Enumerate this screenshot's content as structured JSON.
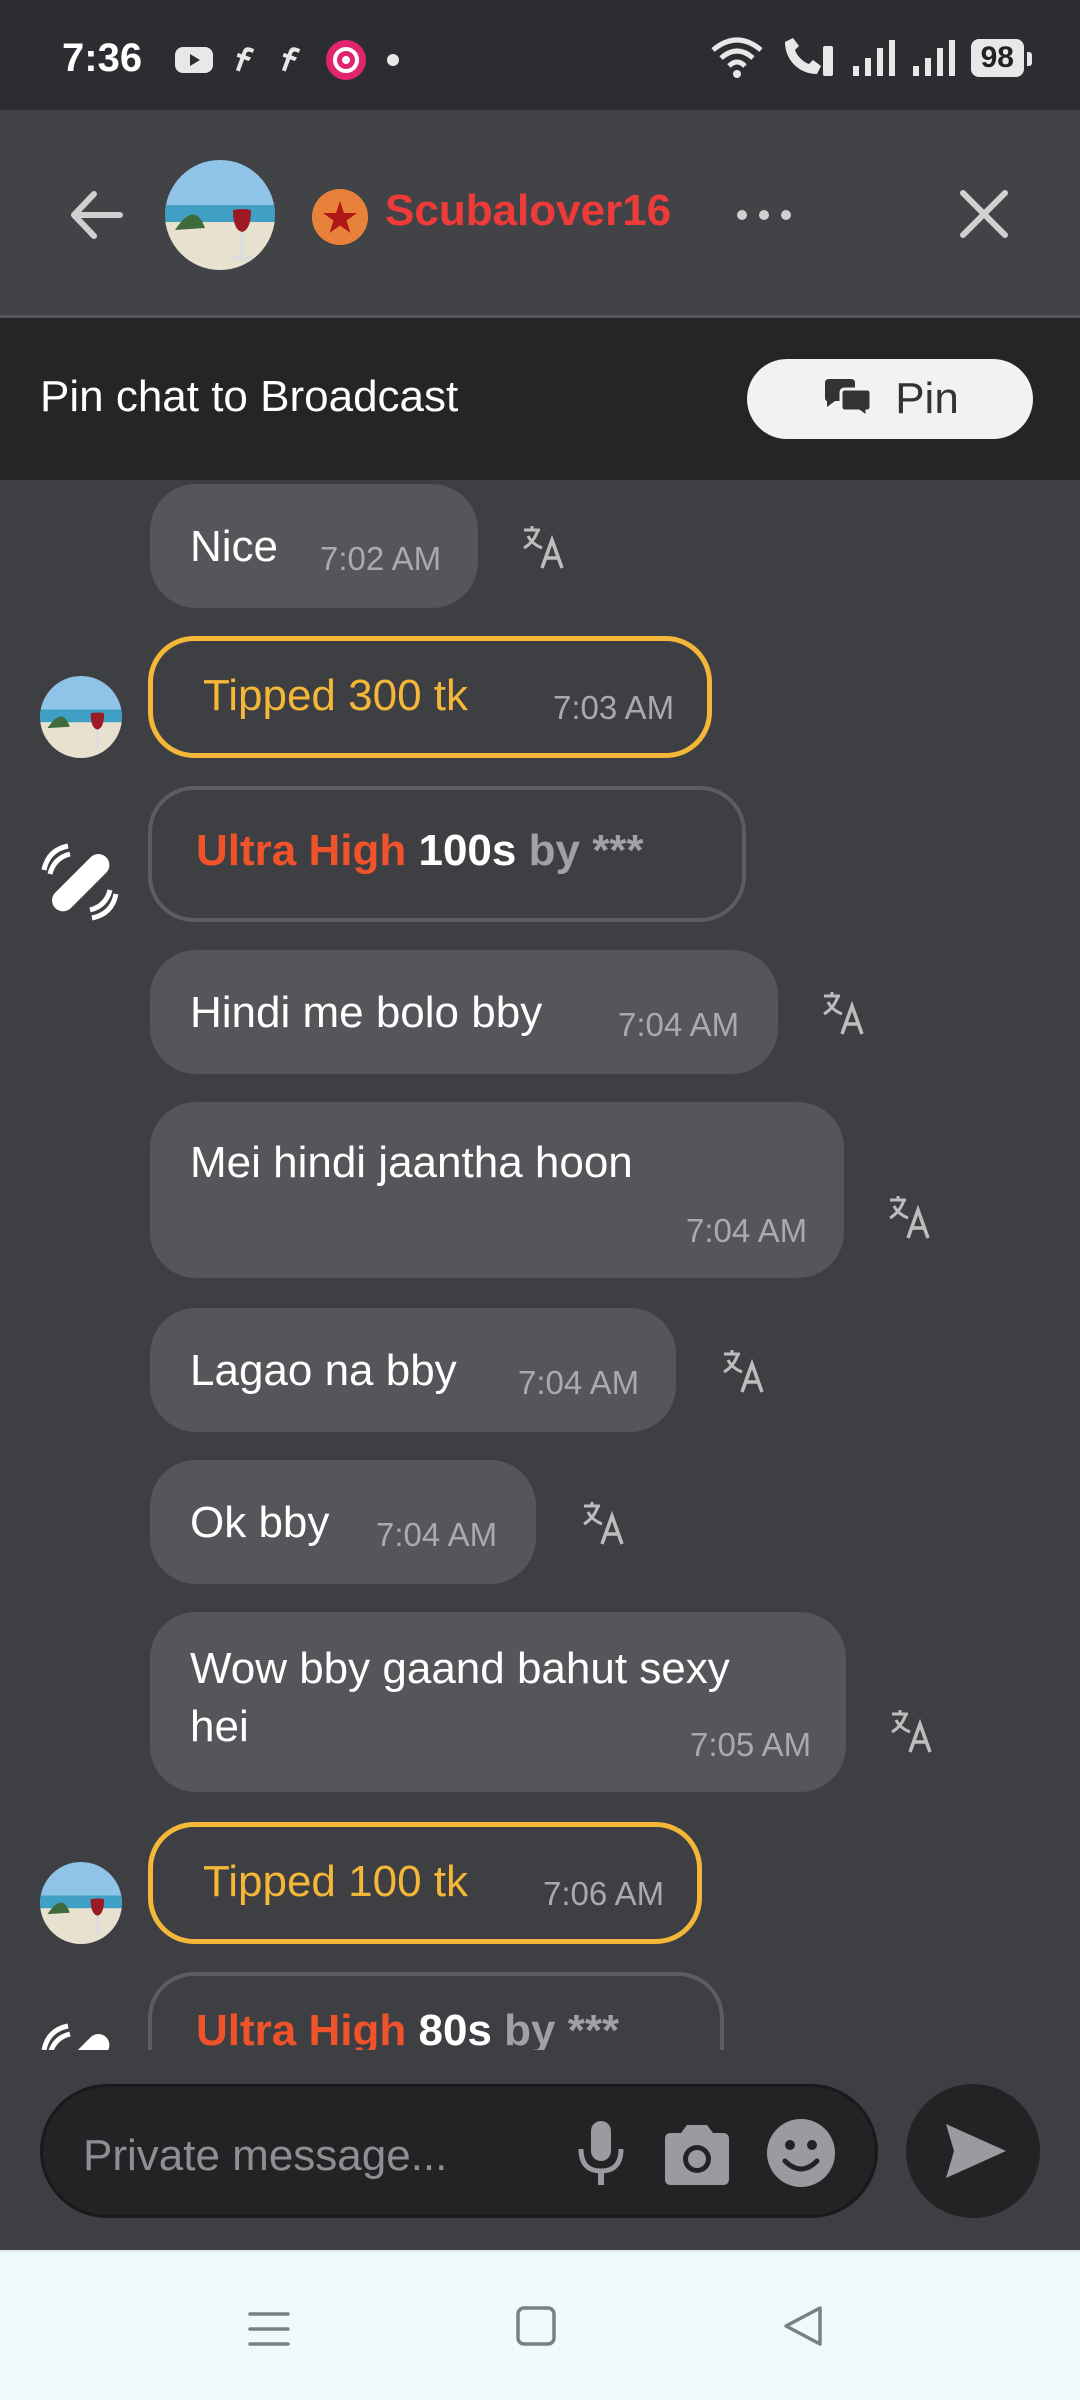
{
  "status_bar": {
    "time": "7:36",
    "battery": "98"
  },
  "header": {
    "username": "Scubalover16"
  },
  "pin_bar": {
    "text": "Pin chat to Broadcast",
    "button_label": "Pin"
  },
  "messages": [
    {
      "type": "text",
      "text": "Nice",
      "time": "7:02 AM"
    },
    {
      "type": "tip",
      "text": "Tipped 300 tk",
      "time": "7:03 AM"
    },
    {
      "type": "ultra",
      "level": "Ultra High",
      "duration": "100s",
      "by": "by",
      "who": "***"
    },
    {
      "type": "text",
      "text": "Hindi me bolo bby",
      "time": "7:04 AM"
    },
    {
      "type": "text",
      "text": "Mei hindi jaantha hoon",
      "time": "7:04 AM"
    },
    {
      "type": "text",
      "text": "Lagao na bby",
      "time": "7:04 AM"
    },
    {
      "type": "text",
      "text": "Ok bby",
      "time": "7:04 AM"
    },
    {
      "type": "text",
      "text_line1": "Wow bby gaand bahut sexy",
      "text_line2": "hei",
      "time": "7:05 AM"
    },
    {
      "type": "tip",
      "text": "Tipped 100 tk",
      "time": "7:06 AM"
    },
    {
      "type": "ultra",
      "level": "Ultra High",
      "duration": "80s",
      "by": "by",
      "who": "***"
    }
  ],
  "composer": {
    "placeholder": "Private message..."
  },
  "colors": {
    "background": "#3e3f43",
    "bubble": "#55565a",
    "tip_border": "#f4b738",
    "username": "#ef3a3a",
    "ultra": "#f0522a"
  },
  "icons": [
    "back-arrow-icon",
    "star-badge-icon",
    "more-icon",
    "close-icon",
    "chat-bubbles-icon",
    "translate-icon",
    "vibration-icon",
    "mic-icon",
    "camera-icon",
    "emoji-icon",
    "send-icon"
  ]
}
